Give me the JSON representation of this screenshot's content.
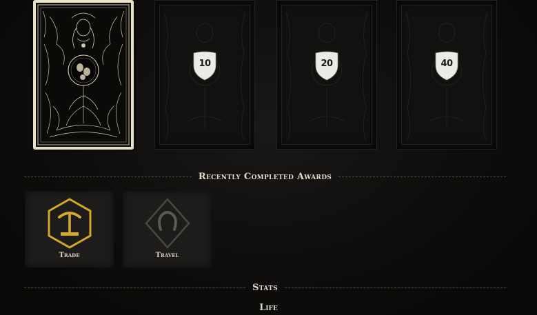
{
  "cards": [
    {
      "state": "unlocked",
      "badge": null
    },
    {
      "state": "locked",
      "badge": "10"
    },
    {
      "state": "locked",
      "badge": "20"
    },
    {
      "state": "locked",
      "badge": "40"
    }
  ],
  "recent_awards": {
    "title": "Recently Completed Awards",
    "items": [
      {
        "label": "Trade",
        "icon": "pickaxe-icon",
        "color": "#d4a82a"
      },
      {
        "label": "Travel",
        "icon": "horseshoe-icon",
        "color": "#4a4844"
      }
    ]
  },
  "stats": {
    "title": "Stats",
    "first_category": "Life"
  },
  "colors": {
    "background": "#0d0c0b",
    "gold_accent": "#d4a82a",
    "card_border": "#e8e0c8",
    "text": "#e0dacb"
  }
}
